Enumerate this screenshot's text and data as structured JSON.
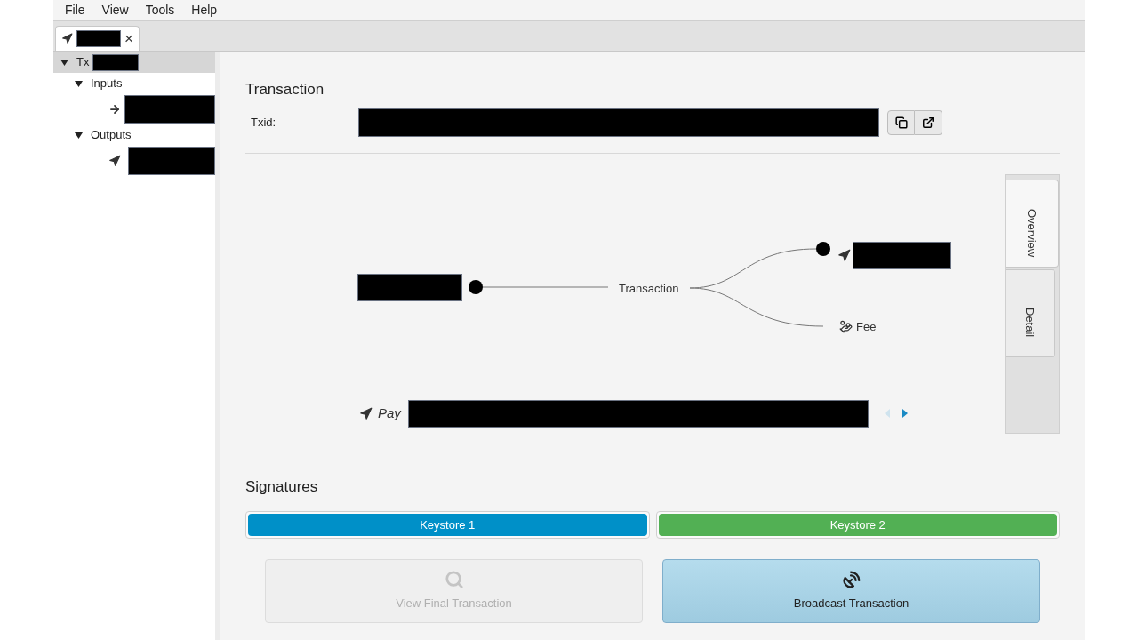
{
  "menu": [
    "File",
    "View",
    "Tools",
    "Help"
  ],
  "tabs": [
    {
      "kind": "output",
      "selected": true,
      "close": "×"
    }
  ],
  "tree": [
    {
      "label": "Tx",
      "kind": "root",
      "expanded": true,
      "selected": true,
      "children": [
        {
          "label": "Inputs",
          "expanded": true,
          "selected": false,
          "children": [
            {
              "kind": "input",
              "selected": false
            }
          ]
        },
        {
          "label": "Outputs",
          "expanded": true,
          "selected": false,
          "children": [
            {
              "kind": "output",
              "selected": false
            }
          ]
        }
      ]
    }
  ],
  "transaction": {
    "title": "Transaction",
    "txid_label": "Txid:"
  },
  "diagram": {
    "center_label": "Transaction",
    "fee_label": "Fee",
    "pay_label": "Pay",
    "pager": {
      "prev_enabled": false,
      "next_enabled": true
    }
  },
  "side_tabs": [
    {
      "label": "Overview",
      "selected": true
    },
    {
      "label": "Detail",
      "selected": false
    }
  ],
  "signatures": {
    "title": "Signatures",
    "keystores": [
      {
        "label": "Keystore 1",
        "color": "#0090c8"
      },
      {
        "label": "Keystore 2",
        "color": "#52b054"
      }
    ]
  },
  "actions": [
    {
      "label": "View Final Transaction",
      "kind": "view",
      "disabled": true
    },
    {
      "label": "Broadcast Transaction",
      "kind": "broadcast",
      "disabled": false
    }
  ]
}
